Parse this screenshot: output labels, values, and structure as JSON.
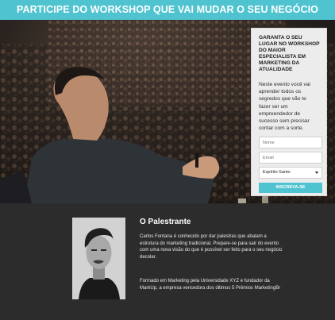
{
  "banner": {
    "title": "PARTICIPE DO WORKSHOP QUE VAI MUDAR O SEU NEGÓCIO"
  },
  "form": {
    "title": "GARANTA O SEU LUGAR NO WORKSHOP DO MAIOR ESPECIALISTA EM MARKETING DA ATUALIDADE",
    "text": "Neste evento você vai aprender todos os segredos que vão te fazer ser um empreendedor de sucesso sem precisar contar com a sorte.",
    "name_placeholder": "Nome",
    "email_placeholder": "Email",
    "state_selected": "Espírito Santo",
    "submit_label": "INSCREVA-SE"
  },
  "about": {
    "title": "O Palestrante",
    "paragraph1": "Carlos Fontana é conhecido por dar palestras que abalam a estrutura do marketing tradicional. Prepare-se para sair do evento com uma nova visão do que é possível ser feito para o seu negócio decolar.",
    "paragraph2": "Formado em Marketing pela Universidade XYZ e fundador da MarkUp, a empresa vencedora dos últimos 5 Prêmios MarketingBr"
  },
  "colors": {
    "accent": "#4fc3cf",
    "dark_bg": "#2c2c2c",
    "card_bg": "#ececec"
  }
}
